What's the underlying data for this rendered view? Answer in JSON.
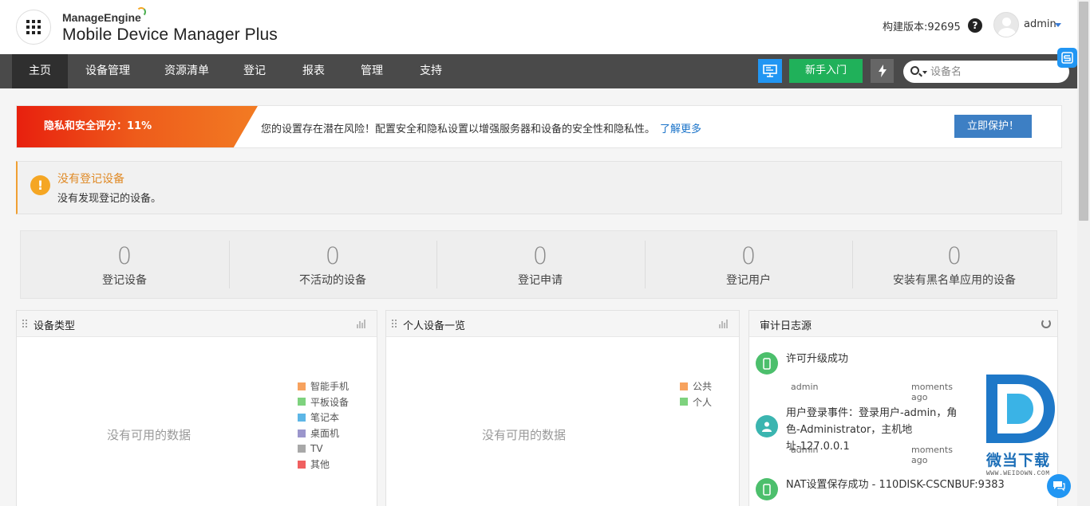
{
  "header": {
    "brand": "ManageEngine",
    "product": "Mobile Device Manager Plus",
    "build": "构建版本:92695",
    "user": "admin"
  },
  "nav": {
    "items": [
      "主页",
      "设备管理",
      "资源清单",
      "登记",
      "报表",
      "管理",
      "支持"
    ],
    "active": "主页",
    "getting_started": "新手入门",
    "search_placeholder": "设备名"
  },
  "privacy": {
    "score_label": "隐私和安全评分：11%",
    "message": "您的设置存在潜在风险！配置安全和隐私设置以增强服务器和设备的安全性和隐私性。",
    "learn_more": "了解更多",
    "protect_button": "立即保护！"
  },
  "alert": {
    "title": "没有登记设备",
    "description": "没有发现登记的设备。"
  },
  "stats": [
    {
      "value": "0",
      "label": "登记设备"
    },
    {
      "value": "0",
      "label": "不活动的设备"
    },
    {
      "value": "0",
      "label": "登记申请"
    },
    {
      "value": "0",
      "label": "登记用户"
    },
    {
      "value": "0",
      "label": "安装有黑名单应用的设备"
    }
  ],
  "device_type_panel": {
    "title": "设备类型",
    "no_data": "没有可用的数据",
    "legend": [
      {
        "label": "智能手机",
        "color": "#f7a25e"
      },
      {
        "label": "平板设备",
        "color": "#7ed27e"
      },
      {
        "label": "笔记本",
        "color": "#5db6e6"
      },
      {
        "label": "桌面机",
        "color": "#9b96cc"
      },
      {
        "label": "TV",
        "color": "#a8a8a8"
      },
      {
        "label": "其他",
        "color": "#f06060"
      }
    ]
  },
  "personal_panel": {
    "title": "个人设备一览",
    "no_data": "没有可用的数据",
    "legend": [
      {
        "label": "公共",
        "color": "#f7a25e"
      },
      {
        "label": "个人",
        "color": "#7ed27e"
      }
    ]
  },
  "audit_panel": {
    "title": "审计日志源",
    "entries": [
      {
        "text": "许可升级成功",
        "user": "admin",
        "time": "moments ago",
        "icon": "device-icon"
      },
      {
        "text": "用户登录事件：登录用户-admin，角色-Administrator，主机地址-127.0.0.1",
        "user": "admin",
        "time": "moments ago",
        "icon": "user-icon"
      },
      {
        "text": "NAT设置保存成功 - 110DISK-CSCNBUF:9383",
        "user": "",
        "time": "",
        "icon": "device-icon"
      }
    ]
  },
  "watermark": {
    "text": "微当下载",
    "url": "WWW.WEIDOWN.COM"
  },
  "colors": {
    "nav_bg": "#4a4a4a",
    "accent_blue": "#2196f3",
    "green": "#20b15a",
    "warning": "#f5a623"
  }
}
